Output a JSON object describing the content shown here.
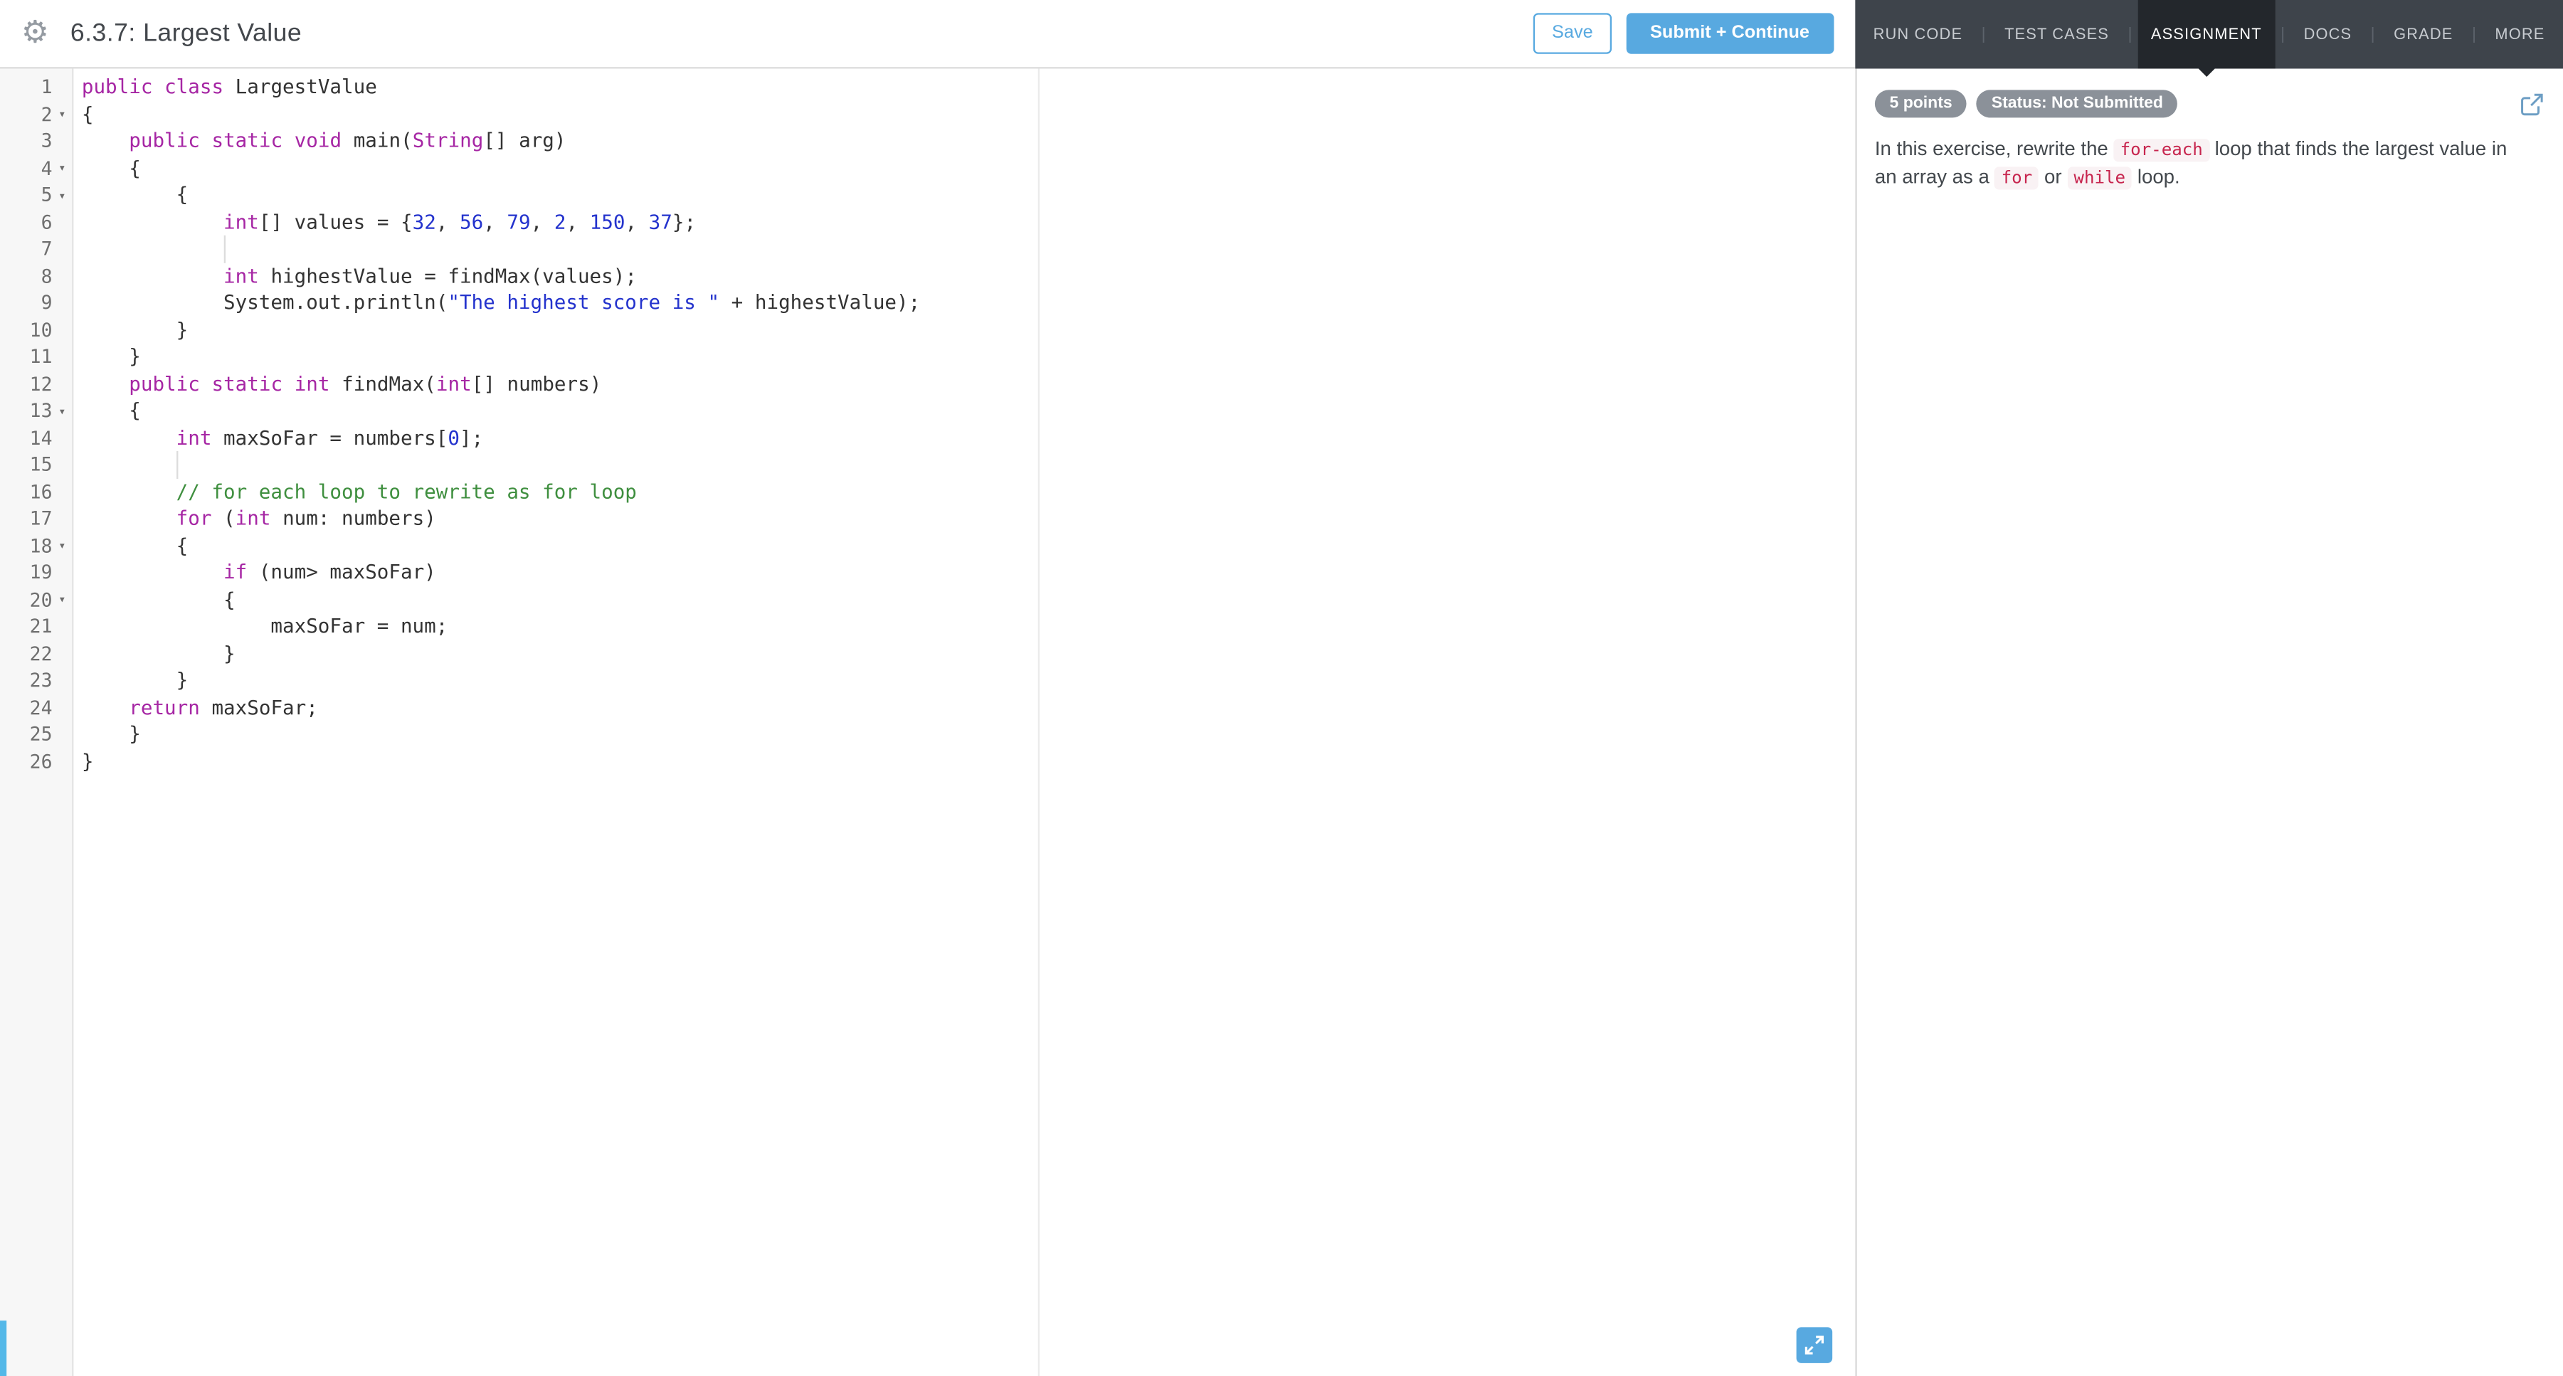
{
  "header": {
    "title": "6.3.7: Largest Value",
    "save_label": "Save",
    "submit_label": "Submit + Continue"
  },
  "right_panel": {
    "tabs": [
      {
        "label": "RUN CODE"
      },
      {
        "label": "TEST CASES"
      },
      {
        "label": "ASSIGNMENT"
      },
      {
        "label": "DOCS"
      },
      {
        "label": "GRADE"
      },
      {
        "label": "MORE"
      }
    ],
    "active_tab": "ASSIGNMENT",
    "points_badge": "5 points",
    "status_badge": "Status: Not Submitted",
    "description": [
      {
        "t": "text",
        "v": "In this exercise, rewrite the "
      },
      {
        "t": "code",
        "v": "for-each"
      },
      {
        "t": "text",
        "v": " loop that finds the largest value in an array as a "
      },
      {
        "t": "code",
        "v": "for"
      },
      {
        "t": "text",
        "v": " or "
      },
      {
        "t": "code",
        "v": "while"
      },
      {
        "t": "text",
        "v": " loop."
      }
    ]
  },
  "icons": {
    "gear": "⚙",
    "fold_arrow": "▾"
  },
  "colors": {
    "accent_blue": "#58a9e0",
    "strip_blue": "#54b8e8",
    "navbar_bg": "#3e444b",
    "navbar_active_bg": "#23272c",
    "badge_bg": "#8b9199",
    "code_red": "#c7254e",
    "code_red_bg": "#f9f2f4",
    "syntax_keyword": "#a626a4",
    "syntax_number": "#2433cd",
    "syntax_string": "#2433cd",
    "syntax_comment": "#3f8f3f",
    "syntax_plain": "#333333",
    "gutter_text": "#6f6f6f"
  },
  "editor": {
    "lines": [
      {
        "n": 1,
        "fold": false,
        "tokens": [
          {
            "t": "kw",
            "v": "public"
          },
          {
            "t": "pl",
            "v": " "
          },
          {
            "t": "kw",
            "v": "class"
          },
          {
            "t": "pl",
            "v": " LargestValue"
          }
        ]
      },
      {
        "n": 2,
        "fold": true,
        "tokens": [
          {
            "t": "pl",
            "v": "{"
          }
        ]
      },
      {
        "n": 3,
        "fold": false,
        "tokens": [
          {
            "t": "pl",
            "v": "    "
          },
          {
            "t": "kw",
            "v": "public"
          },
          {
            "t": "pl",
            "v": " "
          },
          {
            "t": "kw",
            "v": "static"
          },
          {
            "t": "pl",
            "v": " "
          },
          {
            "t": "kw",
            "v": "void"
          },
          {
            "t": "pl",
            "v": " main("
          },
          {
            "t": "kw",
            "v": "String"
          },
          {
            "t": "pl",
            "v": "[] arg)"
          }
        ]
      },
      {
        "n": 4,
        "fold": true,
        "tokens": [
          {
            "t": "pl",
            "v": "    {"
          }
        ]
      },
      {
        "n": 5,
        "fold": true,
        "tokens": [
          {
            "t": "pl",
            "v": "        {"
          }
        ]
      },
      {
        "n": 6,
        "fold": false,
        "tokens": [
          {
            "t": "pl",
            "v": "            "
          },
          {
            "t": "kw",
            "v": "int"
          },
          {
            "t": "pl",
            "v": "[] values = {"
          },
          {
            "t": "num",
            "v": "32"
          },
          {
            "t": "pl",
            "v": ", "
          },
          {
            "t": "num",
            "v": "56"
          },
          {
            "t": "pl",
            "v": ", "
          },
          {
            "t": "num",
            "v": "79"
          },
          {
            "t": "pl",
            "v": ", "
          },
          {
            "t": "num",
            "v": "2"
          },
          {
            "t": "pl",
            "v": ", "
          },
          {
            "t": "num",
            "v": "150"
          },
          {
            "t": "pl",
            "v": ", "
          },
          {
            "t": "num",
            "v": "37"
          },
          {
            "t": "pl",
            "v": "};"
          }
        ]
      },
      {
        "n": 7,
        "fold": false,
        "guide_col": 12,
        "tokens": []
      },
      {
        "n": 8,
        "fold": false,
        "tokens": [
          {
            "t": "pl",
            "v": "            "
          },
          {
            "t": "kw",
            "v": "int"
          },
          {
            "t": "pl",
            "v": " highestValue = findMax(values);"
          }
        ]
      },
      {
        "n": 9,
        "fold": false,
        "tokens": [
          {
            "t": "pl",
            "v": "            System.out.println("
          },
          {
            "t": "str",
            "v": "\"The highest score is \""
          },
          {
            "t": "pl",
            "v": " + highestValue);"
          }
        ]
      },
      {
        "n": 10,
        "fold": false,
        "tokens": [
          {
            "t": "pl",
            "v": "        }"
          }
        ]
      },
      {
        "n": 11,
        "fold": false,
        "tokens": [
          {
            "t": "pl",
            "v": "    }"
          }
        ]
      },
      {
        "n": 12,
        "fold": false,
        "tokens": [
          {
            "t": "pl",
            "v": "    "
          },
          {
            "t": "kw",
            "v": "public"
          },
          {
            "t": "pl",
            "v": " "
          },
          {
            "t": "kw",
            "v": "static"
          },
          {
            "t": "pl",
            "v": " "
          },
          {
            "t": "kw",
            "v": "int"
          },
          {
            "t": "pl",
            "v": " findMax("
          },
          {
            "t": "kw",
            "v": "int"
          },
          {
            "t": "pl",
            "v": "[] numbers)"
          }
        ]
      },
      {
        "n": 13,
        "fold": true,
        "tokens": [
          {
            "t": "pl",
            "v": "    {"
          }
        ]
      },
      {
        "n": 14,
        "fold": false,
        "tokens": [
          {
            "t": "pl",
            "v": "        "
          },
          {
            "t": "kw",
            "v": "int"
          },
          {
            "t": "pl",
            "v": " maxSoFar = numbers["
          },
          {
            "t": "num",
            "v": "0"
          },
          {
            "t": "pl",
            "v": "];"
          }
        ]
      },
      {
        "n": 15,
        "fold": false,
        "guide_col": 8,
        "tokens": []
      },
      {
        "n": 16,
        "fold": false,
        "tokens": [
          {
            "t": "pl",
            "v": "        "
          },
          {
            "t": "com",
            "v": "// for each loop to rewrite as for loop"
          }
        ]
      },
      {
        "n": 17,
        "fold": false,
        "tokens": [
          {
            "t": "pl",
            "v": "        "
          },
          {
            "t": "kw",
            "v": "for"
          },
          {
            "t": "pl",
            "v": " ("
          },
          {
            "t": "kw",
            "v": "int"
          },
          {
            "t": "pl",
            "v": " num: numbers)"
          }
        ]
      },
      {
        "n": 18,
        "fold": true,
        "tokens": [
          {
            "t": "pl",
            "v": "        {"
          }
        ]
      },
      {
        "n": 19,
        "fold": false,
        "tokens": [
          {
            "t": "pl",
            "v": "            "
          },
          {
            "t": "kw",
            "v": "if"
          },
          {
            "t": "pl",
            "v": " (num> maxSoFar)"
          }
        ]
      },
      {
        "n": 20,
        "fold": true,
        "tokens": [
          {
            "t": "pl",
            "v": "            {"
          }
        ]
      },
      {
        "n": 21,
        "fold": false,
        "tokens": [
          {
            "t": "pl",
            "v": "                maxSoFar = num;"
          }
        ]
      },
      {
        "n": 22,
        "fold": false,
        "tokens": [
          {
            "t": "pl",
            "v": "            }"
          }
        ]
      },
      {
        "n": 23,
        "fold": false,
        "tokens": [
          {
            "t": "pl",
            "v": "        }"
          }
        ]
      },
      {
        "n": 24,
        "fold": false,
        "tokens": [
          {
            "t": "pl",
            "v": "    "
          },
          {
            "t": "kw",
            "v": "return"
          },
          {
            "t": "pl",
            "v": " maxSoFar;"
          }
        ]
      },
      {
        "n": 25,
        "fold": false,
        "tokens": [
          {
            "t": "pl",
            "v": "    }"
          }
        ]
      },
      {
        "n": 26,
        "fold": false,
        "tokens": [
          {
            "t": "pl",
            "v": "}"
          }
        ]
      }
    ]
  }
}
